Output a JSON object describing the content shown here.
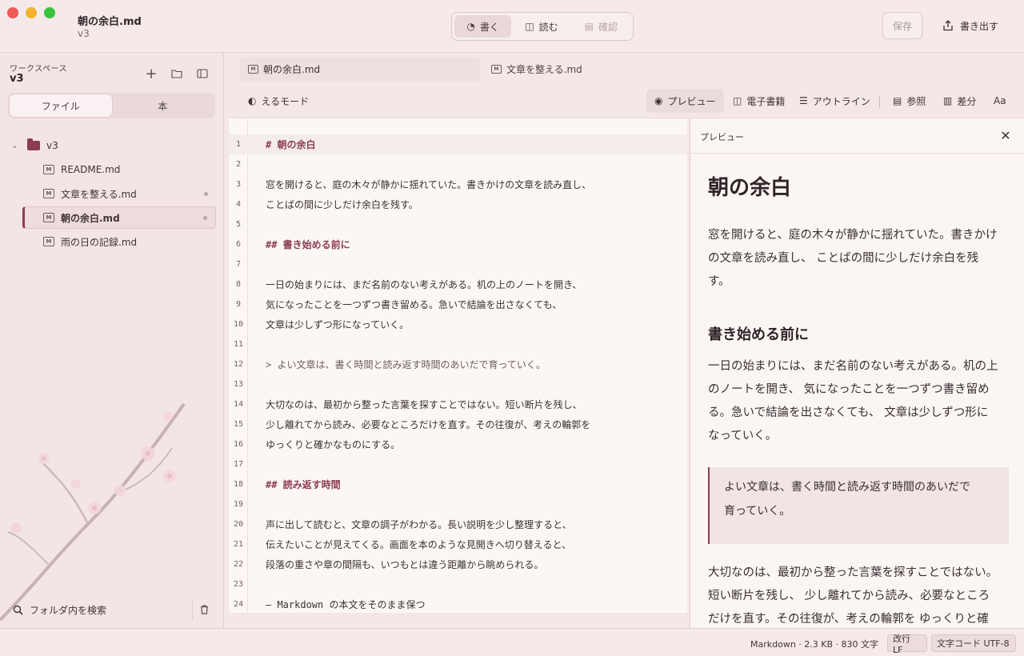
{
  "window": {
    "title": "朝の余白.md",
    "subtitle": "v3"
  },
  "modes": [
    {
      "icon": "pen-icon",
      "label": "書く"
    },
    {
      "icon": "book-open-icon",
      "label": "読む"
    },
    {
      "icon": "check-doc-icon",
      "label": "確認"
    }
  ],
  "header": {
    "save_label": "保存",
    "export_label": "書き出す"
  },
  "sidebar": {
    "workspace_label": "ワークスペース",
    "workspace_name": "v3",
    "tabs": [
      "ファイル",
      "本"
    ],
    "folder": "v3",
    "files": [
      {
        "name": "README.md",
        "modified": false,
        "active": false
      },
      {
        "name": "文章を整える.md",
        "modified": true,
        "active": false
      },
      {
        "name": "朝の余白.md",
        "modified": true,
        "active": true
      },
      {
        "name": "雨の日の記録.md",
        "modified": false,
        "active": false
      }
    ],
    "search_label": "フォルダ内を検索"
  },
  "file_tabs": [
    "朝の余白.md",
    "文章を整える.md"
  ],
  "toolbar": {
    "mode_label": "えるモード",
    "buttons": [
      "プレビュー",
      "電子書籍",
      "アウトライン",
      "参照",
      "差分",
      "Aa"
    ]
  },
  "editor": {
    "current_line": 1,
    "lines": [
      "#  朝の余白",
      "",
      "窓を開けると、庭の木々が静かに揺れていた。書きかけの文章を読み直し、",
      "ことばの間に少しだけ余白を残す。",
      "",
      "##  書き始める前に",
      "",
      "一日の始まりには、まだ名前のない考えがある。机の上のノートを開き、",
      "気になったことを一つずつ書き留める。急いで結論を出さなくても、",
      "文章は少しずつ形になっていく。",
      "",
      ">  よい文章は、書く時間と読み返す時間のあいだで育っていく。",
      "",
      "大切なのは、最初から整った言葉を探すことではない。短い断片を残し、",
      "少し離れてから読み、必要なところだけを直す。その往復が、考えの輪郭を",
      "ゆっくりと確かなものにする。",
      "",
      "##  読み返す時間",
      "",
      "声に出して読むと、文章の調子がわかる。長い説明を少し整理すると、",
      "伝えたいことが見えてくる。画面を本のような見開きへ切り替えると、",
      "段落の重さや章の間隔も、いつもとは違う距離から眺められる。",
      "",
      "—  Markdown  の本文をそのまま保つ"
    ]
  },
  "preview": {
    "title": "プレビュー",
    "h1": "朝の余白",
    "p1": [
      "窓を開けると、庭の木々が静かに揺れていた。書きかけ",
      "の文章を読み直し、 ことばの間に少しだけ余白を残",
      "す。"
    ],
    "h2": "書き始める前に",
    "p2": [
      "一日の始まりには、まだ名前のない考えがある。机の上",
      "のノートを開き、 気になったことを一つずつ書き留め",
      "る。急いで結論を出さなくても、 文章は少しずつ形に",
      "なっていく。"
    ],
    "quote": [
      "よい文章は、書く時間と読み返す時間のあいだで",
      "育っていく。"
    ],
    "p3": [
      "大切なのは、最初から整った言葉を探すことではない。",
      "短い断片を残し、 少し離れてから読み、必要なところ",
      "だけを直す。その往復が、考えの輪郭を ゆっくりと確"
    ]
  },
  "status": {
    "info": "Markdown · 2.3 KB · 830 文字",
    "line_ending": "改行 LF",
    "encoding": "文字コード UTF-8"
  }
}
